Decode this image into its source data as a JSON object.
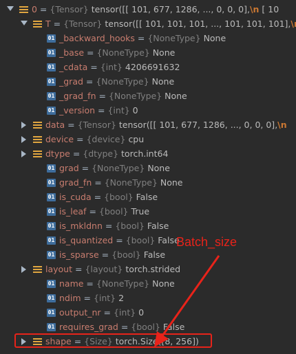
{
  "rows": [
    {
      "indent": 0,
      "arrow": "down",
      "icon": "list",
      "name": "0",
      "type": "{Tensor}",
      "value": "tensor([[ 101,  677, 1286,  ...,    0,    0,    0],",
      "escape": "\\n",
      "tail": "       [ 10"
    },
    {
      "indent": 1,
      "arrow": "down",
      "icon": "list",
      "name": "T",
      "type": "{Tensor}",
      "value": "tensor([[ 101,  101,  101,  ...,  101,  101,  101],",
      "escape": "\\n",
      "tail": ""
    },
    {
      "indent": 2,
      "arrow": "",
      "icon": "01",
      "name": "_backward_hooks",
      "type": "{NoneType}",
      "value": "None",
      "escape": "",
      "tail": ""
    },
    {
      "indent": 2,
      "arrow": "",
      "icon": "01",
      "name": "_base",
      "type": "{NoneType}",
      "value": "None",
      "escape": "",
      "tail": ""
    },
    {
      "indent": 2,
      "arrow": "",
      "icon": "01",
      "name": "_cdata",
      "type": "{int}",
      "value": "4206691632",
      "escape": "",
      "tail": ""
    },
    {
      "indent": 2,
      "arrow": "",
      "icon": "01",
      "name": "_grad",
      "type": "{NoneType}",
      "value": "None",
      "escape": "",
      "tail": ""
    },
    {
      "indent": 2,
      "arrow": "",
      "icon": "01",
      "name": "_grad_fn",
      "type": "{NoneType}",
      "value": "None",
      "escape": "",
      "tail": ""
    },
    {
      "indent": 2,
      "arrow": "",
      "icon": "01",
      "name": "_version",
      "type": "{int}",
      "value": "0",
      "escape": "",
      "tail": ""
    },
    {
      "indent": 1,
      "arrow": "right",
      "icon": "list",
      "name": "data",
      "type": "{Tensor}",
      "value": "tensor([[ 101,  677, 1286,  ...,    0,    0,    0],",
      "escape": "\\n",
      "tail": ""
    },
    {
      "indent": 1,
      "arrow": "right",
      "icon": "list",
      "name": "device",
      "type": "{device}",
      "value": "cpu",
      "escape": "",
      "tail": ""
    },
    {
      "indent": 1,
      "arrow": "right",
      "icon": "list",
      "name": "dtype",
      "type": "{dtype}",
      "value": "torch.int64",
      "escape": "",
      "tail": ""
    },
    {
      "indent": 2,
      "arrow": "",
      "icon": "01",
      "name": "grad",
      "type": "{NoneType}",
      "value": "None",
      "escape": "",
      "tail": ""
    },
    {
      "indent": 2,
      "arrow": "",
      "icon": "01",
      "name": "grad_fn",
      "type": "{NoneType}",
      "value": "None",
      "escape": "",
      "tail": ""
    },
    {
      "indent": 2,
      "arrow": "",
      "icon": "01",
      "name": "is_cuda",
      "type": "{bool}",
      "value": "False",
      "escape": "",
      "tail": ""
    },
    {
      "indent": 2,
      "arrow": "",
      "icon": "01",
      "name": "is_leaf",
      "type": "{bool}",
      "value": "True",
      "escape": "",
      "tail": ""
    },
    {
      "indent": 2,
      "arrow": "",
      "icon": "01",
      "name": "is_mkldnn",
      "type": "{bool}",
      "value": "False",
      "escape": "",
      "tail": ""
    },
    {
      "indent": 2,
      "arrow": "",
      "icon": "01",
      "name": "is_quantized",
      "type": "{bool}",
      "value": "False",
      "escape": "",
      "tail": ""
    },
    {
      "indent": 2,
      "arrow": "",
      "icon": "01",
      "name": "is_sparse",
      "type": "{bool}",
      "value": "False",
      "escape": "",
      "tail": ""
    },
    {
      "indent": 1,
      "arrow": "right",
      "icon": "list",
      "name": "layout",
      "type": "{layout}",
      "value": "torch.strided",
      "escape": "",
      "tail": ""
    },
    {
      "indent": 2,
      "arrow": "",
      "icon": "01",
      "name": "name",
      "type": "{NoneType}",
      "value": "None",
      "escape": "",
      "tail": ""
    },
    {
      "indent": 2,
      "arrow": "",
      "icon": "01",
      "name": "ndim",
      "type": "{int}",
      "value": "2",
      "escape": "",
      "tail": ""
    },
    {
      "indent": 2,
      "arrow": "",
      "icon": "01",
      "name": "output_nr",
      "type": "{int}",
      "value": "0",
      "escape": "",
      "tail": ""
    },
    {
      "indent": 2,
      "arrow": "",
      "icon": "01",
      "name": "requires_grad",
      "type": "{bool}",
      "value": "False",
      "escape": "",
      "tail": ""
    },
    {
      "indent": 1,
      "arrow": "right",
      "icon": "list",
      "name": "shape",
      "type": "{Size}",
      "value": "torch.Size([8, 256])",
      "escape": "",
      "tail": ""
    }
  ],
  "annotation": {
    "label": "Batch_size",
    "color": "#e8231a"
  },
  "colors": {
    "background": "#2b2b2b",
    "var_name": "#c87d6f",
    "type_hint": "#808080",
    "value": "#bbbbbb",
    "list_icon": "#e2a740",
    "field_icon": "#3e6d9c"
  }
}
